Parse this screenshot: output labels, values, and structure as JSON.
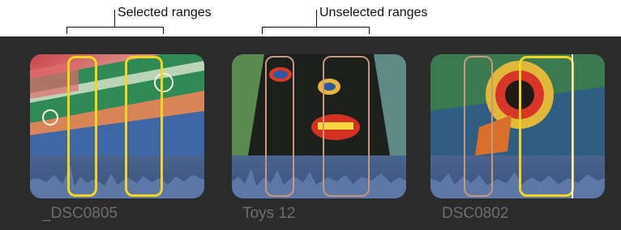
{
  "callouts": {
    "selected_label": "Selected ranges",
    "unselected_label": "Unselected ranges"
  },
  "clips": [
    {
      "name": "_DSC0805"
    },
    {
      "name": "Toys 12"
    },
    {
      "name": "DSC0802"
    }
  ],
  "colors": {
    "browser_bg": "#2b2b2c",
    "selected_range": "#f2d51f",
    "unselected_range": "#c8977d",
    "audio_waveform": "#4a6390",
    "clip_name_text": "#6e6e6e"
  }
}
